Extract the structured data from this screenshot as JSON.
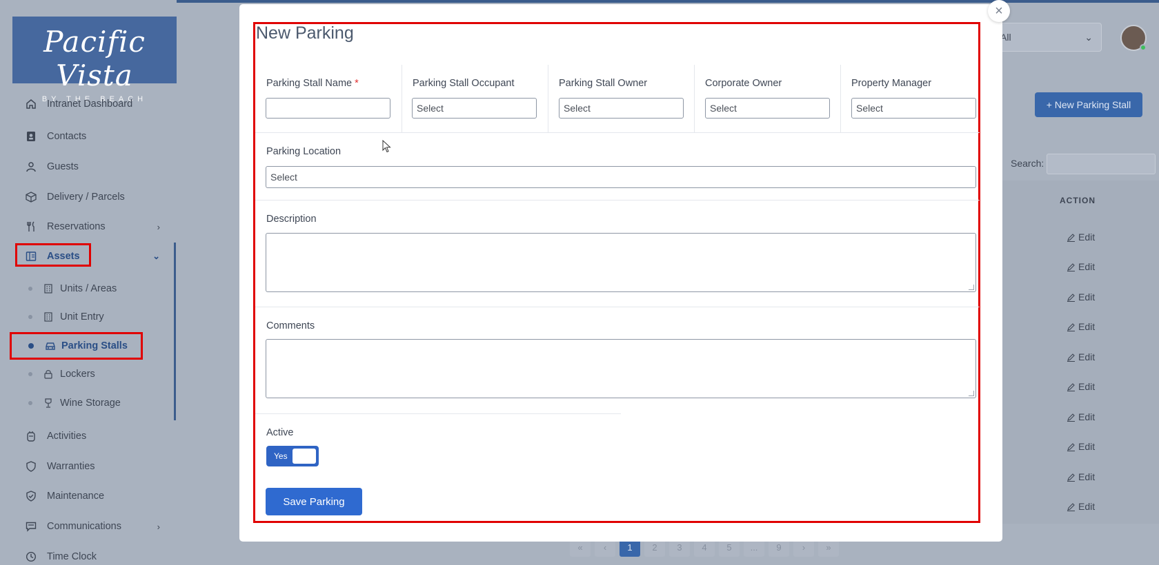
{
  "brand": {
    "title": "Pacific Vista",
    "subtitle": "BY THE BEACH"
  },
  "sidebar": {
    "items": [
      {
        "label": "Intranet Dashboard",
        "icon": "home-icon"
      },
      {
        "label": "Contacts",
        "icon": "contacts-icon"
      },
      {
        "label": "Guests",
        "icon": "user-icon"
      },
      {
        "label": "Delivery / Parcels",
        "icon": "package-icon"
      },
      {
        "label": "Reservations",
        "icon": "fork-knife-icon"
      },
      {
        "label": "Assets",
        "icon": "layout-icon"
      },
      {
        "label": "Activities",
        "icon": "activity-icon"
      },
      {
        "label": "Warranties",
        "icon": "shield-icon"
      },
      {
        "label": "Maintenance",
        "icon": "shield-check-icon"
      },
      {
        "label": "Communications",
        "icon": "message-icon"
      },
      {
        "label": "Time Clock",
        "icon": "clock-icon"
      }
    ],
    "assets_sub": [
      {
        "label": "Units / Areas"
      },
      {
        "label": "Unit Entry"
      },
      {
        "label": "Parking Stalls"
      },
      {
        "label": "Lockers"
      },
      {
        "label": "Wine Storage"
      }
    ]
  },
  "background": {
    "filter_value": "All",
    "new_button": "+ New Parking Stall",
    "search_label": "Search:",
    "action_header": "ACTION",
    "edit_label": "Edit",
    "pages": [
      "«",
      "‹",
      "1",
      "2",
      "3",
      "4",
      "5",
      "...",
      "9",
      "›",
      "»"
    ]
  },
  "modal": {
    "title": "New Parking",
    "close_glyph": "×",
    "fields": {
      "stall_name": {
        "label": "Parking Stall Name",
        "required_mark": "*",
        "value": ""
      },
      "occupant": {
        "label": "Parking Stall Occupant",
        "placeholder": "Select"
      },
      "owner": {
        "label": "Parking Stall Owner",
        "placeholder": "Select"
      },
      "corporate": {
        "label": "Corporate Owner",
        "placeholder": "Select"
      },
      "manager": {
        "label": "Property Manager",
        "placeholder": "Select"
      },
      "location": {
        "label": "Parking Location",
        "placeholder": "Select"
      },
      "description": {
        "label": "Description"
      },
      "comments": {
        "label": "Comments"
      },
      "active": {
        "label": "Active",
        "toggle_text": "Yes"
      }
    },
    "save_label": "Save Parking"
  },
  "colors": {
    "accent": "#2f6ad0",
    "highlight": "#e00000",
    "sidebar_active": "#2a4e86"
  }
}
